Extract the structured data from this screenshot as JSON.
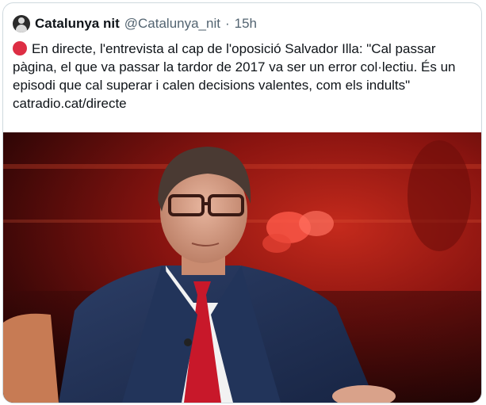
{
  "tweet": {
    "author_name": "Catalunya nit",
    "handle": "@Catalunya_nit",
    "separator": "·",
    "time": "15h",
    "text": "En directe, l'entrevista al cap de l'oposició Salvador Illa: \"Cal passar pàgina, el que va passar la tardor de 2017 va ser un error col·lectiu. És un episodi que cal superar i calen decisions valentes, com els indults\"",
    "link": "catradio.cat/directe"
  },
  "icons": {
    "live": "red-circle-emoji",
    "avatar": "profile-avatar"
  }
}
